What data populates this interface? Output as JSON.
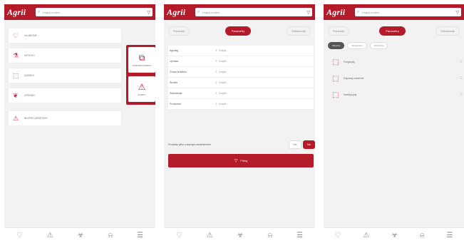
{
  "app": {
    "logo": "Agrii",
    "search_placeholder": "Znajdź środek...",
    "accent": "#b31b2b"
  },
  "nav": {
    "icons": [
      "heart-icon",
      "warning-icon",
      "hazard-icon",
      "bell-icon",
      "document-icon"
    ]
  },
  "screen1": {
    "menu": [
      {
        "label": "Ulubione",
        "icon": "heart-icon"
      },
      {
        "label": "Notatki",
        "icon": "flask-icon"
      },
      {
        "label": "Zabiegi",
        "icon": "bottle-icon"
      },
      {
        "label": "Uprawy",
        "icon": "plant-icon"
      },
      {
        "label": "Bezpieczeństwo",
        "icon": "hazard-icon"
      }
    ],
    "popup": [
      {
        "label": "Porównywarka",
        "icon": "compare-icon"
      },
      {
        "label": "Alerty",
        "icon": "alert-icon"
      }
    ]
  },
  "tabs": [
    "Produkty",
    "Parametry",
    "Substancje"
  ],
  "active_tab": 1,
  "screen2": {
    "fields": [
      {
        "label": "Agrofag",
        "placeholder": "Znajdź..."
      },
      {
        "label": "Uprawa",
        "placeholder": "Znajdź..."
      },
      {
        "label": "Grupa środków",
        "placeholder": "Znajdź..."
      },
      {
        "label": "Środek",
        "placeholder": "Znajdź..."
      },
      {
        "label": "Substancja",
        "placeholder": "Znajdź..."
      },
      {
        "label": "Producent",
        "placeholder": "Znajdź..."
      }
    ],
    "toggle_label": "Produkty tylko z ważnym zezwoleniem",
    "toggle_off": "Nie",
    "toggle_on": "Tak",
    "filter_label": "Filtruj"
  },
  "screen3": {
    "chips": [
      "Aktywne",
      "Nieaktywne",
      "Wszystkie"
    ],
    "items": [
      {
        "label": "Fungicydy"
      },
      {
        "label": "Zaprawy nasienne"
      },
      {
        "label": "Insektycydy"
      }
    ]
  }
}
